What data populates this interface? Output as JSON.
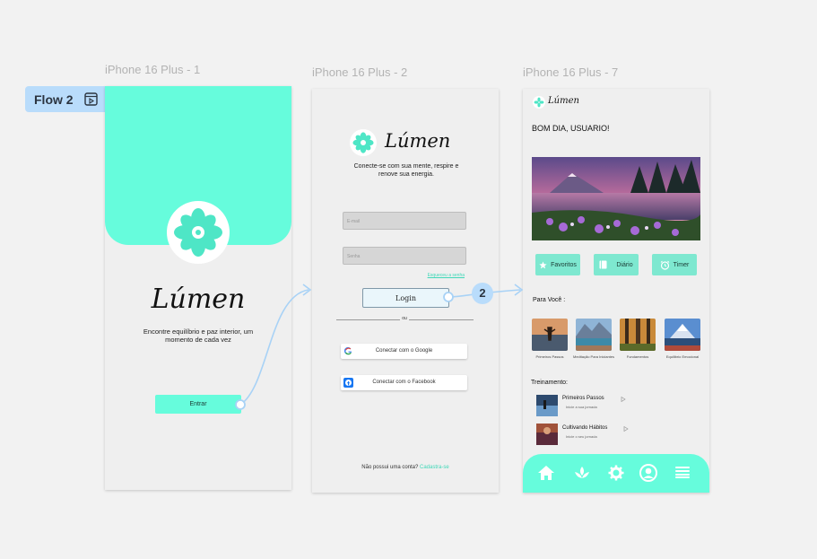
{
  "canvas": {
    "flow_badge": {
      "label": "Flow 2"
    },
    "frame_titles": [
      "iPhone 16 Plus - 1",
      "iPhone 16 Plus - 2",
      "iPhone 16 Plus - 7"
    ],
    "connector_step": "2"
  },
  "screen1": {
    "brand": "Lúmen",
    "tagline": "Encontre equilíbrio e paz interior, um momento de cada vez",
    "enter_button": "Entrar"
  },
  "screen2": {
    "brand": "Lúmen",
    "subtitle": "Conecte-se com sua mente, respire e renove sua energia.",
    "email_placeholder": "E-mail",
    "password_placeholder": "Senha",
    "forgot_link": "Esqueceu a senha",
    "login_button": "Login",
    "divider": "ou",
    "google_button": "Conectar com o Google",
    "facebook_button": "Conectar com o Facebook",
    "signup_prompt": "Não possui uma conta?",
    "signup_link": "Cadastra-se"
  },
  "screen7": {
    "brand": "Lúmen",
    "greeting": "BOM DIA, USUARIO!",
    "quick_actions": [
      {
        "label": "Favoritos",
        "icon": "star-icon"
      },
      {
        "label": "Diário",
        "icon": "book-icon"
      },
      {
        "label": "Timer",
        "icon": "alarm-icon"
      }
    ],
    "for_you_title": "Para Você :",
    "for_you": [
      {
        "label": "Primeiros Passos"
      },
      {
        "label": "Meditação Para Iniciantes"
      },
      {
        "label": "Fundamentos"
      },
      {
        "label": "Equilibrio Emocional"
      }
    ],
    "training_title": "Treinamento:",
    "training": [
      {
        "title": "Primeiros Passos",
        "sub": "Inicie a sua jornada"
      },
      {
        "title": "Cultivando Hábitos",
        "sub": "Inicie o seu jornada"
      }
    ],
    "nav": [
      "home-icon",
      "lotus-icon",
      "gear-icon",
      "profile-icon",
      "menu-icon"
    ]
  },
  "colors": {
    "accent": "#66fcdc",
    "badge": "#b9dcfb",
    "connector": "#a8d2f6"
  }
}
